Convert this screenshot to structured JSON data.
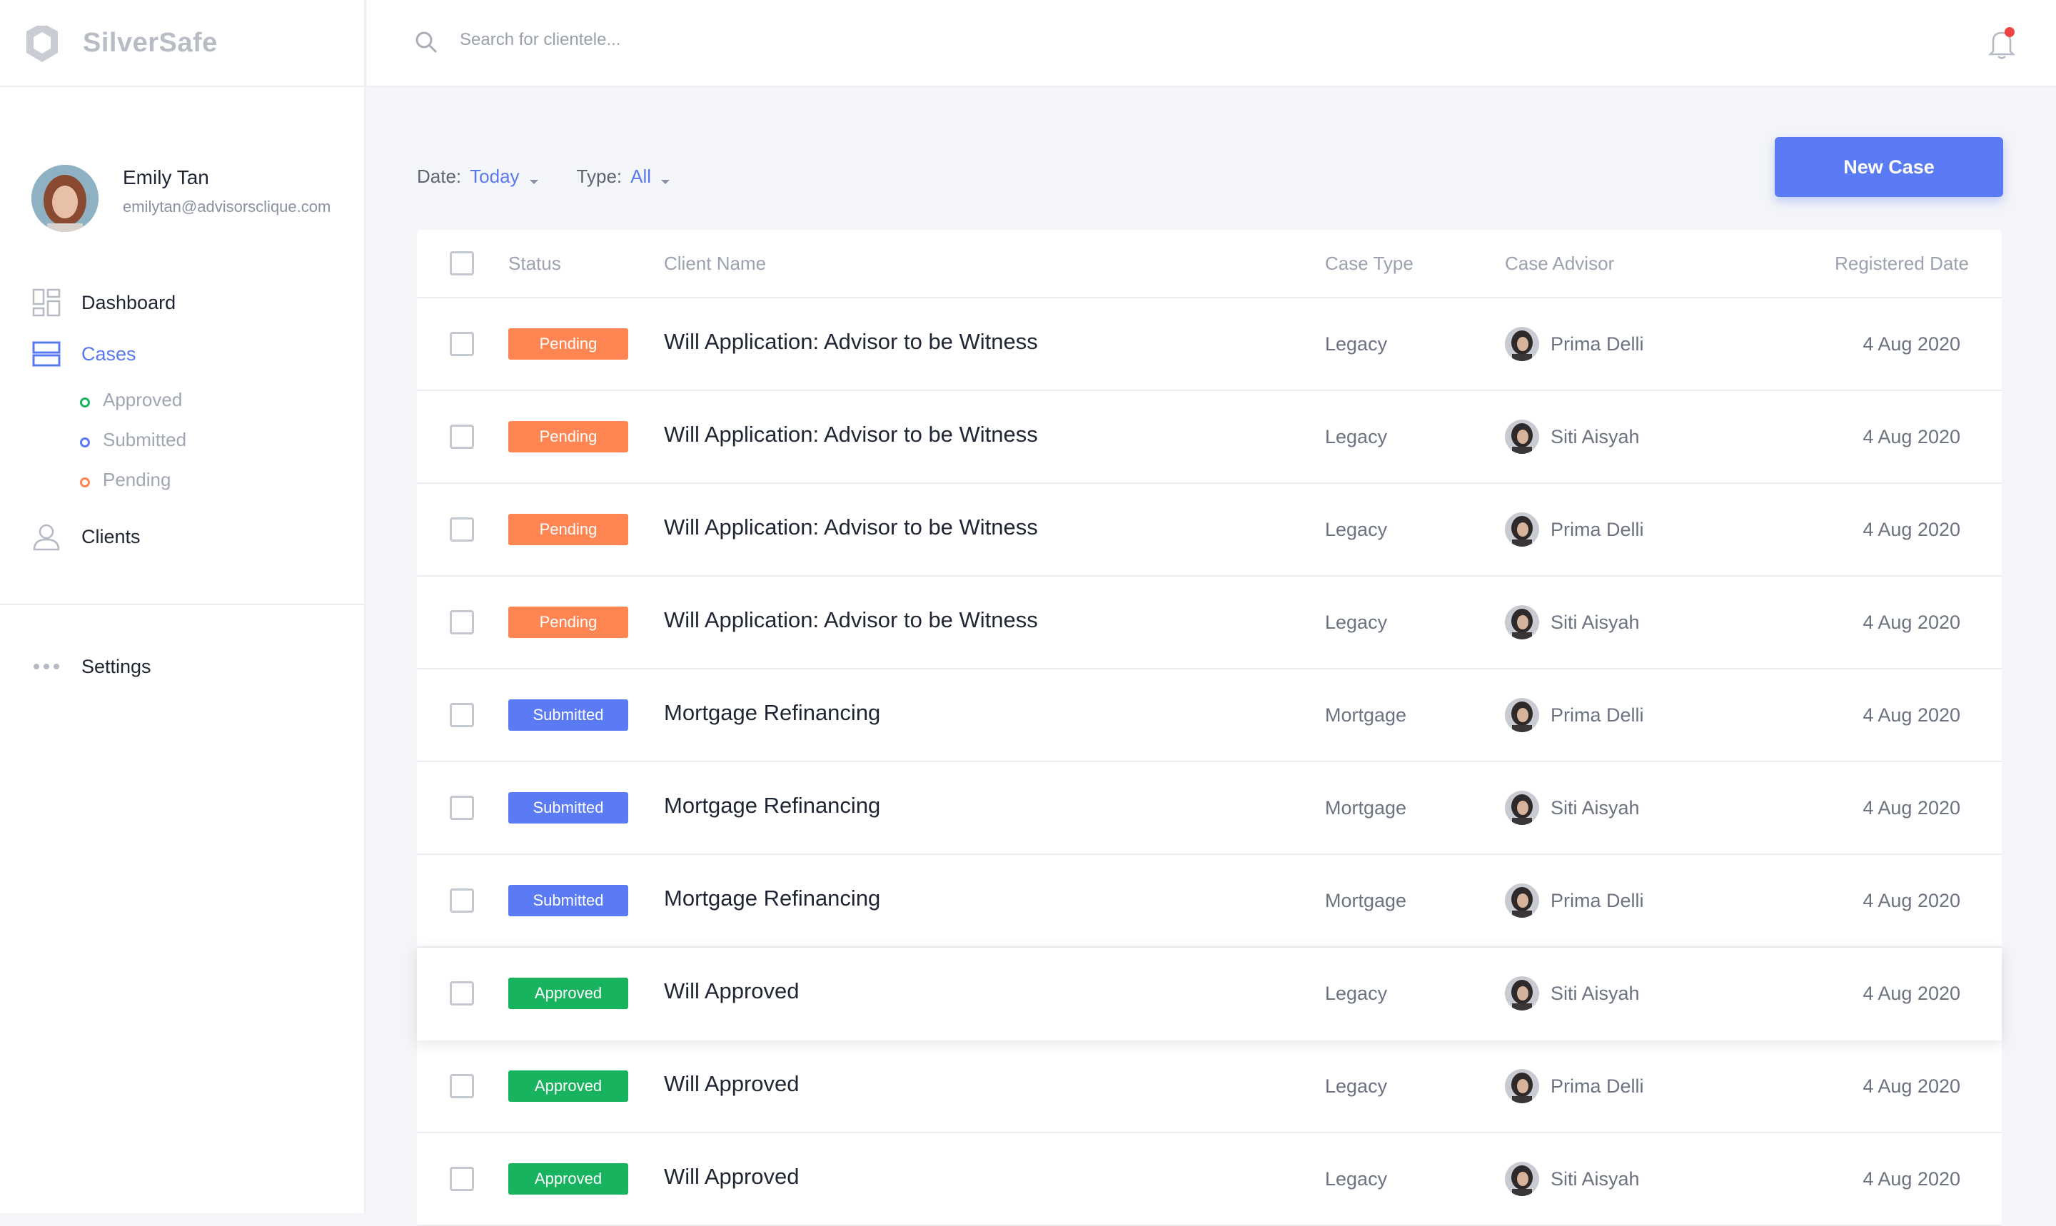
{
  "app": {
    "name": "SilverSafe"
  },
  "user": {
    "name": "Emily Tan",
    "email": "emilytan@advisorsclique.com"
  },
  "nav": {
    "dashboard": "Dashboard",
    "cases": "Cases",
    "sub": [
      {
        "label": "Approved",
        "color": "#18b35e"
      },
      {
        "label": "Submitted",
        "color": "#5b7bf5"
      },
      {
        "label": "Pending",
        "color": "#ff8552"
      }
    ],
    "clients": "Clients",
    "settings": "Settings"
  },
  "search": {
    "placeholder": "Search for clientele..."
  },
  "filters": {
    "date_label": "Date:",
    "date_value": "Today",
    "type_label": "Type:",
    "type_value": "All"
  },
  "actions": {
    "new_case": "New Case"
  },
  "table": {
    "columns": {
      "status": "Status",
      "client": "Client Name",
      "type": "Case Type",
      "advisor": "Case Advisor",
      "date": "Registered Date"
    },
    "rows": [
      {
        "status": "Pending",
        "client": "Will Application: Advisor to be Witness",
        "type": "Legacy",
        "advisor": "Prima Delli",
        "date": "4 Aug 2020"
      },
      {
        "status": "Pending",
        "client": "Will Application: Advisor to be Witness",
        "type": "Legacy",
        "advisor": "Siti Aisyah",
        "date": "4 Aug 2020"
      },
      {
        "status": "Pending",
        "client": "Will Application: Advisor to be Witness",
        "type": "Legacy",
        "advisor": "Prima Delli",
        "date": "4 Aug 2020"
      },
      {
        "status": "Pending",
        "client": "Will Application: Advisor to be Witness",
        "type": "Legacy",
        "advisor": "Siti Aisyah",
        "date": "4 Aug 2020"
      },
      {
        "status": "Submitted",
        "client": "Mortgage Refinancing",
        "type": "Mortgage",
        "advisor": "Prima Delli",
        "date": "4 Aug 2020"
      },
      {
        "status": "Submitted",
        "client": "Mortgage Refinancing",
        "type": "Mortgage",
        "advisor": "Siti Aisyah",
        "date": "4 Aug 2020"
      },
      {
        "status": "Submitted",
        "client": "Mortgage Refinancing",
        "type": "Mortgage",
        "advisor": "Prima Delli",
        "date": "4 Aug 2020"
      },
      {
        "status": "Approved",
        "client": "Will Approved",
        "type": "Legacy",
        "advisor": "Siti Aisyah",
        "date": "4 Aug 2020"
      },
      {
        "status": "Approved",
        "client": "Will Approved",
        "type": "Legacy",
        "advisor": "Prima Delli",
        "date": "4 Aug 2020"
      },
      {
        "status": "Approved",
        "client": "Will Approved",
        "type": "Legacy",
        "advisor": "Siti Aisyah",
        "date": "4 Aug 2020"
      }
    ]
  },
  "status_colors": {
    "Pending": "#ff8552",
    "Submitted": "#5b7bf5",
    "Approved": "#18b35e"
  },
  "accent": "#5b7bf5",
  "notification_dot": "#ef4444"
}
